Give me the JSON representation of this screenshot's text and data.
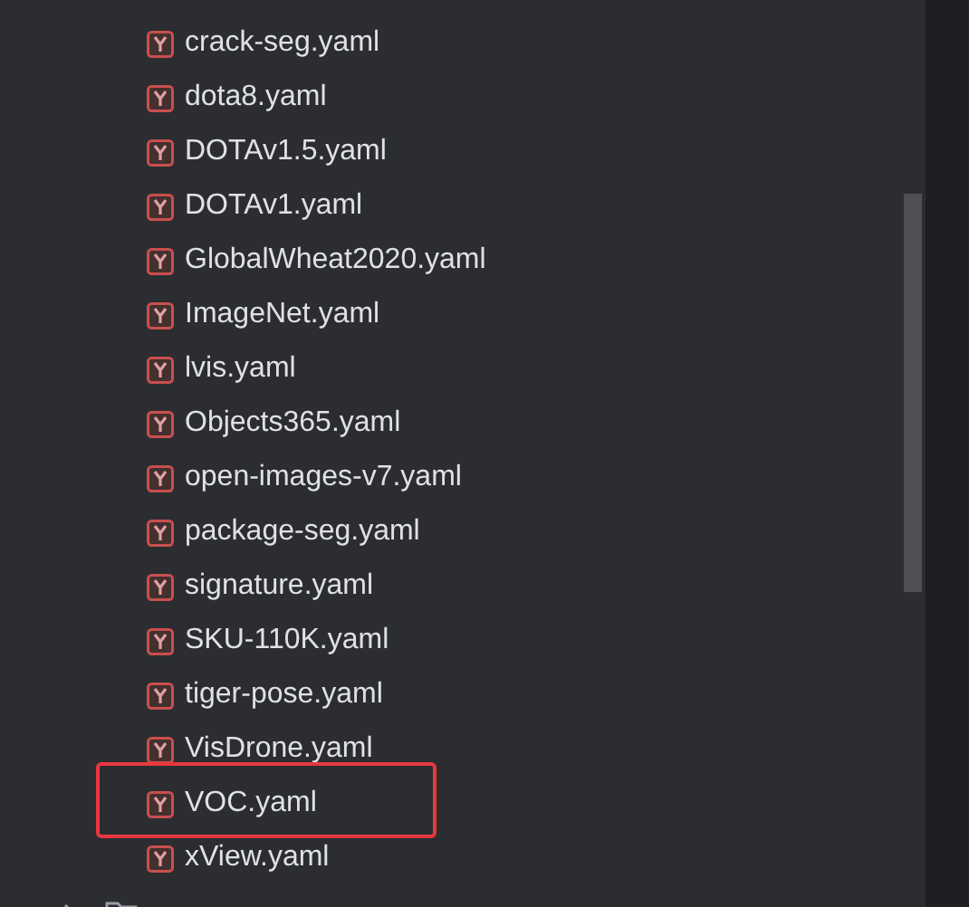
{
  "files": [
    {
      "name": "crack-seg.yaml",
      "highlighted": false
    },
    {
      "name": "dota8.yaml",
      "highlighted": false
    },
    {
      "name": "DOTAv1.5.yaml",
      "highlighted": false
    },
    {
      "name": "DOTAv1.yaml",
      "highlighted": false
    },
    {
      "name": "GlobalWheat2020.yaml",
      "highlighted": false
    },
    {
      "name": "ImageNet.yaml",
      "highlighted": false
    },
    {
      "name": "lvis.yaml",
      "highlighted": false
    },
    {
      "name": "Objects365.yaml",
      "highlighted": false
    },
    {
      "name": "open-images-v7.yaml",
      "highlighted": false
    },
    {
      "name": "package-seg.yaml",
      "highlighted": false
    },
    {
      "name": "signature.yaml",
      "highlighted": false
    },
    {
      "name": "SKU-110K.yaml",
      "highlighted": false
    },
    {
      "name": "tiger-pose.yaml",
      "highlighted": false
    },
    {
      "name": "VisDrone.yaml",
      "highlighted": false
    },
    {
      "name": "VOC.yaml",
      "highlighted": true
    },
    {
      "name": "xView.yaml",
      "highlighted": false
    }
  ]
}
